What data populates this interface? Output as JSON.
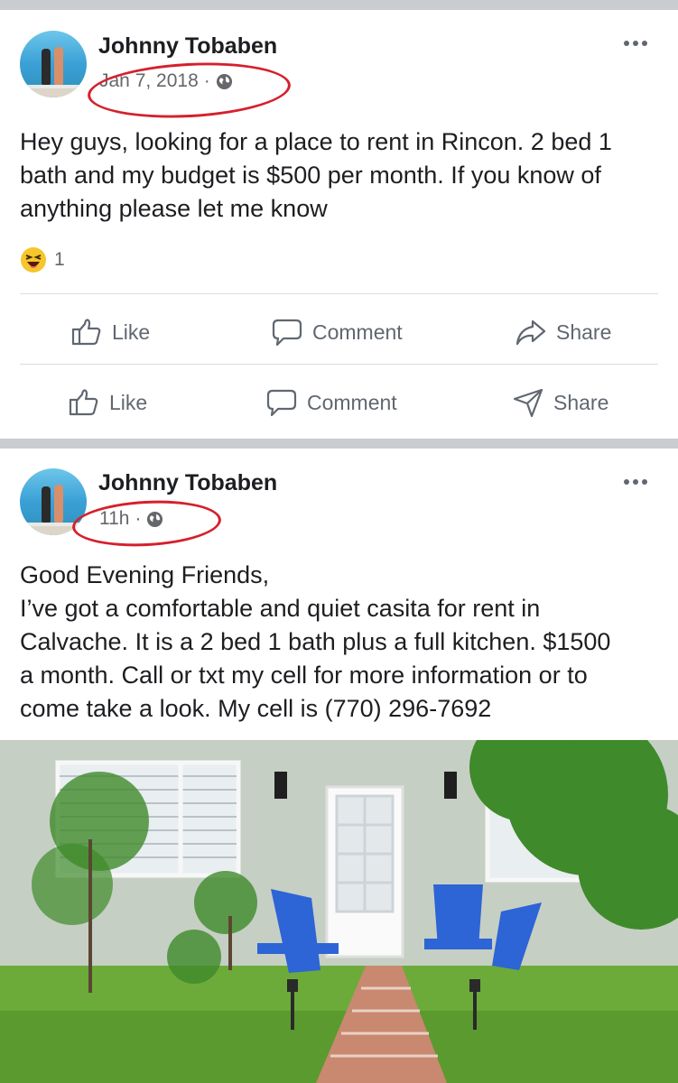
{
  "posts": [
    {
      "author": "Johnny Tobaben",
      "timestamp": "Jan 7, 2018",
      "separator": "·",
      "privacy_icon": "globe-icon",
      "text": "Hey guys, looking for a place to rent in Rincon. 2 bed 1\nbath and my budget is $500 per month. If you know of\nanything please let me know",
      "reaction": {
        "icon": "haha-emoji-icon",
        "count": "1"
      },
      "actions": [
        {
          "label": "Like",
          "icon": "thumbs-up-icon"
        },
        {
          "label": "Comment",
          "icon": "comment-bubble-icon"
        },
        {
          "label": "Share",
          "icon": "share-arrow-icon"
        }
      ],
      "actions_second_row": [
        {
          "label": "Like",
          "icon": "thumbs-up-icon"
        },
        {
          "label": "Comment",
          "icon": "comment-bubble-icon"
        },
        {
          "label": "Share",
          "icon": "paper-plane-icon"
        }
      ]
    },
    {
      "author": "Johnny Tobaben",
      "timestamp": "11h",
      "separator": "·",
      "privacy_icon": "globe-icon",
      "text": "Good Evening Friends,\nI’ve got a comfortable and quiet casita for rent in\nCalvache. It is a 2 bed 1 bath plus a full kitchen. $1500\na month. Call or txt my cell for more information or to\ncome take a look. My cell is (770) 296-7692",
      "photo_description": "house-photo"
    }
  ],
  "colors": {
    "separator": "#c9ccd1",
    "annotation_circle": "#d5202c",
    "secondary_text": "#65676b"
  }
}
